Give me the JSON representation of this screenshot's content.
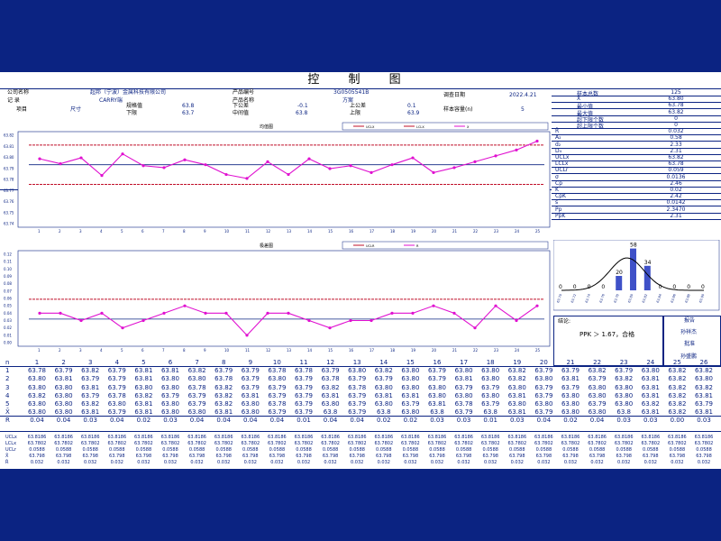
{
  "title": "控 制 图",
  "header": {
    "company_label": "公司名称",
    "company_value": "超邦（宁波）金属科技有限公司",
    "product_no_label": "产品编号",
    "product_no_value": "3G0505541B",
    "survey_date_label": "调查日期",
    "survey_date_value": "2022.4.21",
    "record_label": "记 录",
    "record_value": "CARRY端",
    "product_name_label": "产品名称",
    "product_name_value": "方案",
    "item_label": "项目",
    "item_value": "尺寸",
    "spec_label": "规格值",
    "spec_value": "63.8",
    "lower_tol_label": "下公差",
    "lower_tol_value": "-0.1",
    "upper_tol_label": "上公差",
    "upper_tol_value": "0.1",
    "sample_size_label": "样本容量(n)",
    "sample_size_value": "5",
    "lower_limit_label": "下限",
    "lower_limit_value": "63.7",
    "median_label": "中间值",
    "median_value": "63.8",
    "upper_limit_label": "上限",
    "upper_limit_value": "63.9"
  },
  "stats": [
    {
      "label": "样本总数",
      "value": "125"
    },
    {
      "label": "X̄",
      "value": "63.80"
    },
    {
      "label": "最小值",
      "value": "63.78"
    },
    {
      "label": "最大值",
      "value": "63.82"
    },
    {
      "label": "超下限个数",
      "value": "0"
    },
    {
      "label": "超上限个数",
      "value": "0"
    },
    {
      "label": "R̄",
      "value": "0.032"
    },
    {
      "label": "A₂",
      "value": "0.58"
    },
    {
      "label": "d₂",
      "value": "2.33"
    },
    {
      "label": "D₄",
      "value": "2.31"
    },
    {
      "label": "UCLx",
      "value": "63.82"
    },
    {
      "label": "LCLx",
      "value": "63.78"
    },
    {
      "label": "UCLr",
      "value": "0.059"
    },
    {
      "label": "σ",
      "value": "0.0136"
    },
    {
      "label": "Cp",
      "value": "2.46"
    },
    {
      "label": "K",
      "value": "0.02"
    },
    {
      "label": "CpK",
      "value": "2.42"
    },
    {
      "label": "s",
      "value": "0.0142"
    },
    {
      "label": "Pp",
      "value": "2.3470"
    },
    {
      "label": "PpK",
      "value": "2.31"
    }
  ],
  "conclusion": {
    "label": "结论:",
    "text": "PPK ＞ 1.67，合格",
    "sign1_label": "报告",
    "sign1_name": "孙祥杰",
    "sign2_label": "批准",
    "sign2_name": "孙盛鹏"
  },
  "table": {
    "n_label": "n",
    "row_labels": [
      "1",
      "2",
      "3",
      "4",
      "5",
      "X̄",
      "R"
    ],
    "footer_labels": [
      "UCLx",
      "LCLx",
      "UCLr",
      "X̄",
      "R̄"
    ]
  },
  "chart_data": [
    {
      "type": "line",
      "title": "均值图",
      "legend": [
        "UCLX",
        "LCLX",
        "X"
      ],
      "x": [
        1,
        2,
        3,
        4,
        5,
        6,
        7,
        8,
        9,
        10,
        11,
        12,
        13,
        14,
        15,
        16,
        17,
        18,
        19,
        20,
        21,
        22,
        23,
        24,
        25
      ],
      "values": [
        63.806,
        63.801,
        63.807,
        63.789,
        63.811,
        63.799,
        63.797,
        63.805,
        63.8,
        63.79,
        63.786,
        63.803,
        63.79,
        63.806,
        63.796,
        63.799,
        63.792,
        63.8,
        63.807,
        63.792,
        63.797,
        63.803,
        63.809,
        63.815,
        63.824
      ],
      "ucl": 63.82,
      "lcl": 63.78,
      "center": 63.8,
      "ylim": [
        63.74,
        63.83
      ],
      "yticks": [
        "63.82",
        "63.81",
        "63.80",
        "63.79",
        "63.78",
        "63.77",
        "63.76",
        "63.75",
        "63.74"
      ],
      "colors": {
        "series": "#e010d0",
        "limits": "#c0102a",
        "center": "#0b2382"
      }
    },
    {
      "type": "line",
      "title": "极差图",
      "legend": [
        "UCLR",
        "R"
      ],
      "x": [
        1,
        2,
        3,
        4,
        5,
        6,
        7,
        8,
        9,
        10,
        11,
        12,
        13,
        14,
        15,
        16,
        17,
        18,
        19,
        20,
        21,
        22,
        23,
        24,
        25
      ],
      "values": [
        0.04,
        0.04,
        0.03,
        0.04,
        0.02,
        0.03,
        0.04,
        0.05,
        0.04,
        0.04,
        0.01,
        0.04,
        0.04,
        0.03,
        0.02,
        0.03,
        0.03,
        0.04,
        0.04,
        0.05,
        0.04,
        0.02,
        0.05,
        0.03,
        0.05
      ],
      "ucl": 0.059,
      "center": 0.032,
      "ylim": [
        0.0,
        0.12
      ],
      "yticks": [
        "0.12",
        "0.11",
        "0.10",
        "0.09",
        "0.08",
        "0.07",
        "0.06",
        "0.05",
        "0.04",
        "0.03",
        "0.02",
        "0.01",
        "0.00"
      ],
      "colors": {
        "series": "#e010d0",
        "limits": "#c0102a",
        "center": "#0b2382"
      }
    },
    {
      "type": "bar",
      "title": "",
      "categories": [
        "63.70",
        "63.72",
        "63.74",
        "63.76",
        "63.78",
        "63.80",
        "63.82",
        "63.84",
        "63.86",
        "63.88",
        "63.90"
      ],
      "values": [
        0,
        0,
        0,
        0,
        20,
        58,
        34,
        0,
        0,
        0,
        0
      ],
      "colors": {
        "bar": "#3f51c8",
        "curve": "#000000"
      }
    }
  ],
  "columns": [
    {
      "n": "1",
      "v": [
        "63.78",
        "63.80",
        "63.80",
        "63.82",
        "63.80",
        "63.80",
        "0.04"
      ]
    },
    {
      "n": "2",
      "v": [
        "63.79",
        "63.81",
        "63.80",
        "63.80",
        "63.80",
        "63.80",
        "0.04"
      ]
    },
    {
      "n": "3",
      "v": [
        "63.82",
        "63.79",
        "63.81",
        "63.79",
        "63.82",
        "63.81",
        "0.03"
      ]
    },
    {
      "n": "4",
      "v": [
        "63.79",
        "63.79",
        "63.79",
        "63.78",
        "63.80",
        "63.79",
        "0.04"
      ]
    },
    {
      "n": "5",
      "v": [
        "63.81",
        "63.81",
        "63.80",
        "63.82",
        "63.81",
        "63.81",
        "0.02"
      ]
    },
    {
      "n": "6",
      "v": [
        "63.81",
        "63.80",
        "63.80",
        "63.79",
        "63.80",
        "63.80",
        "0.03"
      ]
    },
    {
      "n": "7",
      "v": [
        "63.82",
        "63.80",
        "63.78",
        "63.79",
        "63.79",
        "63.80",
        "0.04"
      ]
    },
    {
      "n": "8",
      "v": [
        "63.79",
        "63.78",
        "63.82",
        "63.82",
        "63.82",
        "63.81",
        "0.04"
      ]
    },
    {
      "n": "9",
      "v": [
        "63.79",
        "63.79",
        "63.79",
        "63.81",
        "63.80",
        "63.80",
        "0.04"
      ]
    },
    {
      "n": "10",
      "v": [
        "63.78",
        "63.80",
        "63.79",
        "63.79",
        "63.78",
        "63.79",
        "0.04"
      ]
    },
    {
      "n": "11",
      "v": [
        "63.78",
        "63.79",
        "63.79",
        "63.79",
        "63.79",
        "63.79",
        "0.01"
      ]
    },
    {
      "n": "12",
      "v": [
        "63.79",
        "63.78",
        "63.82",
        "63.81",
        "63.80",
        "63.8",
        "0.04"
      ]
    },
    {
      "n": "13",
      "v": [
        "63.80",
        "63.79",
        "63.78",
        "63.79",
        "63.79",
        "63.79",
        "0.04"
      ]
    },
    {
      "n": "14",
      "v": [
        "63.82",
        "63.79",
        "63.80",
        "63.81",
        "63.80",
        "63.8",
        "0.02"
      ]
    },
    {
      "n": "15",
      "v": [
        "63.80",
        "63.80",
        "63.80",
        "63.81",
        "63.79",
        "63.80",
        "0.02"
      ]
    },
    {
      "n": "16",
      "v": [
        "63.79",
        "63.79",
        "63.80",
        "63.80",
        "63.81",
        "63.8",
        "0.03"
      ]
    },
    {
      "n": "17",
      "v": [
        "63.80",
        "63.81",
        "63.79",
        "63.80",
        "63.78",
        "63.79",
        "0.03"
      ]
    },
    {
      "n": "18",
      "v": [
        "63.80",
        "63.80",
        "63.79",
        "63.80",
        "63.79",
        "63.8",
        "0.01"
      ]
    },
    {
      "n": "19",
      "v": [
        "63.82",
        "63.82",
        "63.80",
        "63.81",
        "63.80",
        "63.81",
        "0.03"
      ]
    },
    {
      "n": "20",
      "v": [
        "63.79",
        "63.80",
        "63.79",
        "63.79",
        "63.80",
        "63.79",
        "0.04"
      ]
    },
    {
      "n": "21",
      "v": [
        "63.79",
        "63.81",
        "63.79",
        "63.80",
        "63.80",
        "63.80",
        "0.02"
      ]
    },
    {
      "n": "22",
      "v": [
        "63.82",
        "63.79",
        "63.80",
        "63.80",
        "63.79",
        "63.80",
        "0.04"
      ]
    },
    {
      "n": "23",
      "v": [
        "63.79",
        "63.82",
        "63.80",
        "63.80",
        "63.80",
        "63.8",
        "0.03"
      ]
    },
    {
      "n": "24",
      "v": [
        "63.80",
        "63.81",
        "63.81",
        "63.81",
        "63.82",
        "63.81",
        "0.03"
      ]
    },
    {
      "n": "25",
      "v": [
        "63.82",
        "63.82",
        "63.82",
        "63.82",
        "63.82",
        "63.82",
        "0.00"
      ]
    },
    {
      "n": "26",
      "v": [
        "63.82",
        "63.80",
        "63.82",
        "63.81",
        "63.79",
        "63.81",
        "0.03"
      ]
    }
  ],
  "footer_rows": [
    [
      "63.8186",
      "63.7802",
      "0.0588",
      "63.798",
      "0.032"
    ]
  ]
}
